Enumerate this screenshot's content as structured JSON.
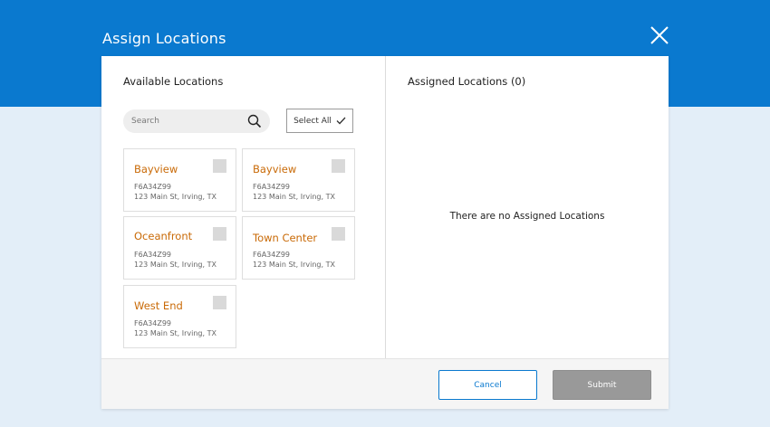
{
  "dialog": {
    "title": "Assign Locations",
    "close_icon": "close-icon"
  },
  "available": {
    "heading": "Available Locations",
    "search": {
      "placeholder": "Search",
      "value": "",
      "icon": "search-icon"
    },
    "select_all_label": "Select All",
    "select_all_icon": "checkmark-icon",
    "locations": [
      {
        "name": "Bayview",
        "code": "F6A34Z99",
        "address": "123 Main St, Irving, TX",
        "checked": false
      },
      {
        "name": "Bayview",
        "code": "F6A34Z99",
        "address": "123 Main St, Irving, TX",
        "checked": false
      },
      {
        "name": "Oceanfront",
        "code": "F6A34Z99",
        "address": "123 Main St, Irving, TX",
        "checked": false
      },
      {
        "name": "Town Center",
        "code": "F6A34Z99",
        "address": "123 Main St, Irving, TX",
        "checked": false
      },
      {
        "name": "West End",
        "code": "F6A34Z99",
        "address": "123 Main St, Irving, TX",
        "checked": false
      }
    ]
  },
  "assigned": {
    "heading": "Assigned Locations (0)",
    "empty_message": "There are no Assigned Locations"
  },
  "footer": {
    "cancel_label": "Cancel",
    "submit_label": "Submit"
  },
  "colors": {
    "header_blue": "#0a79cf",
    "page_background": "#e3eef8",
    "location_name": "#c96a07",
    "submit_disabled": "#999999"
  }
}
